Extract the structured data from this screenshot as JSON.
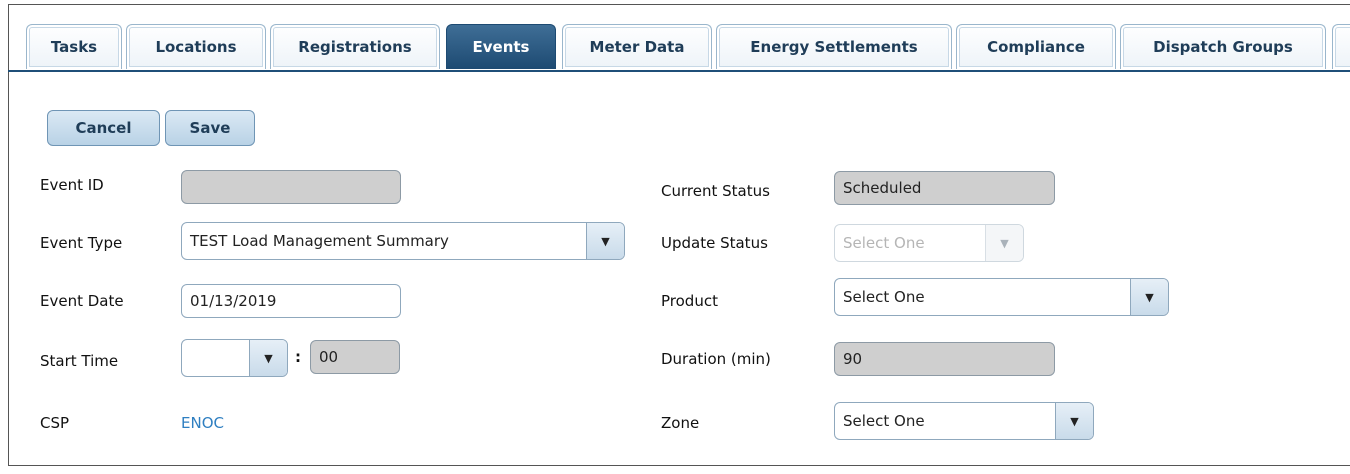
{
  "tabs": [
    {
      "label": "Tasks",
      "active": false
    },
    {
      "label": "Locations",
      "active": false
    },
    {
      "label": "Registrations",
      "active": false
    },
    {
      "label": "Events",
      "active": true
    },
    {
      "label": "Meter Data",
      "active": false
    },
    {
      "label": "Energy Settlements",
      "active": false
    },
    {
      "label": "Compliance",
      "active": false
    },
    {
      "label": "Dispatch Groups",
      "active": false
    }
  ],
  "toolbar": {
    "cancel_label": "Cancel",
    "save_label": "Save"
  },
  "form": {
    "event_id": {
      "label": "Event ID",
      "value": ""
    },
    "event_type": {
      "label": "Event Type",
      "value": "TEST Load Management Summary"
    },
    "event_date": {
      "label": "Event Date",
      "value": "01/13/2019"
    },
    "start_time": {
      "label": "Start Time",
      "hour": "",
      "separator": ":",
      "minute": "00"
    },
    "csp": {
      "label": "CSP",
      "value": "ENOC"
    },
    "current_status": {
      "label": "Current Status",
      "value": "Scheduled"
    },
    "update_status": {
      "label": "Update Status",
      "value": "Select One"
    },
    "product": {
      "label": "Product",
      "value": "Select One"
    },
    "duration": {
      "label": "Duration (min)",
      "value": "90"
    },
    "zone": {
      "label": "Zone",
      "value": "Select One"
    }
  },
  "icons": {
    "dropdown": "▼"
  }
}
